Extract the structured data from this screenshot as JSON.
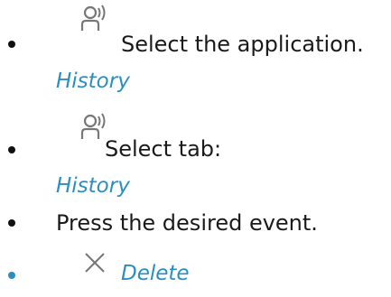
{
  "steps": [
    {
      "icon": "person-signal-icon",
      "text": "Select the application.",
      "sub": "History"
    },
    {
      "icon": "person-signal-icon",
      "text": "Select tab:",
      "sub": "History"
    },
    {
      "text": "Press the desired event."
    },
    {
      "icon": "delete-x-icon",
      "sub": "Delete"
    }
  ],
  "colors": {
    "text": "#1a1a1a",
    "accent": "#2a8fc0",
    "icon": "#777777"
  }
}
